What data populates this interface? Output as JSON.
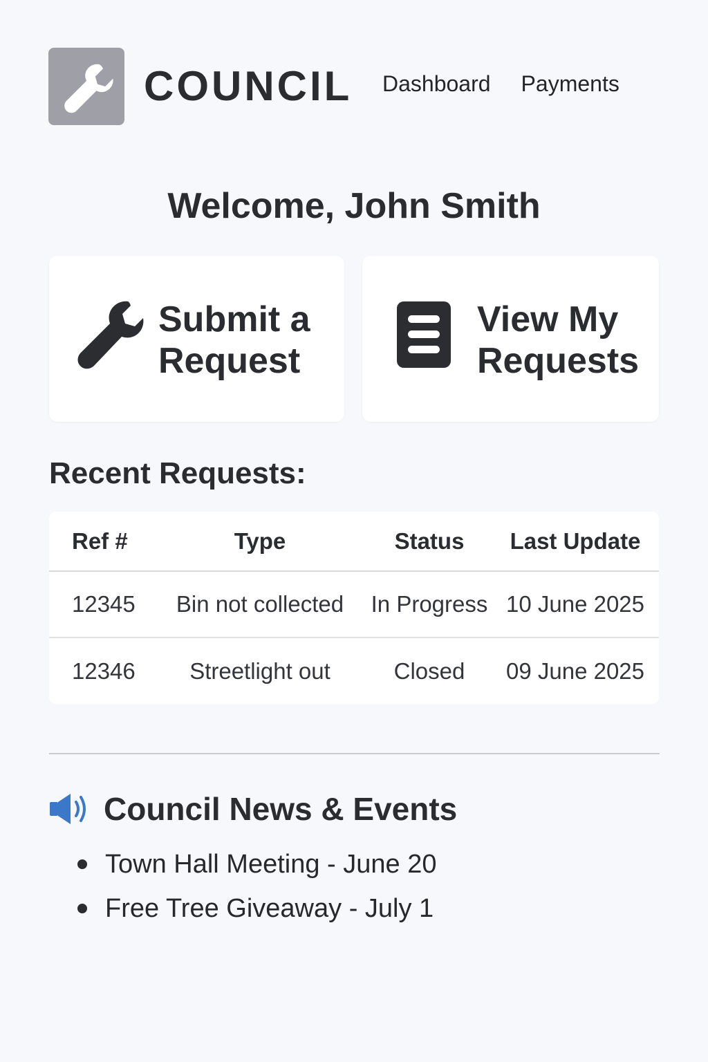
{
  "header": {
    "brand": "COUNCIL",
    "logo_icon": "wrench-icon",
    "nav": [
      {
        "label": "Dashboard"
      },
      {
        "label": "Payments"
      }
    ]
  },
  "welcome": "Welcome, John Smith",
  "actions": [
    {
      "label": "Submit a\nRequest",
      "icon": "wrench-icon"
    },
    {
      "label": "View My\nRequests",
      "icon": "document-icon"
    }
  ],
  "recent": {
    "title": "Recent Requests:",
    "columns": [
      "Ref #",
      "Type",
      "Status",
      "Last Update"
    ],
    "rows": [
      [
        "12345",
        "Bin not collected",
        "In Progress",
        "10 June 2025"
      ],
      [
        "12346",
        "Streetlight out",
        "Closed",
        "09 June 2025"
      ]
    ]
  },
  "news": {
    "title": "Council News & Events",
    "icon": "megaphone-icon",
    "items": [
      "Town Hall Meeting - June 20",
      "Free Tree Giveaway - July 1"
    ]
  },
  "colors": {
    "background": "#f6f8fc",
    "logo_box": "#9fa0a7",
    "accent_icon": "#3b78c9",
    "text": "#2a2c30"
  }
}
